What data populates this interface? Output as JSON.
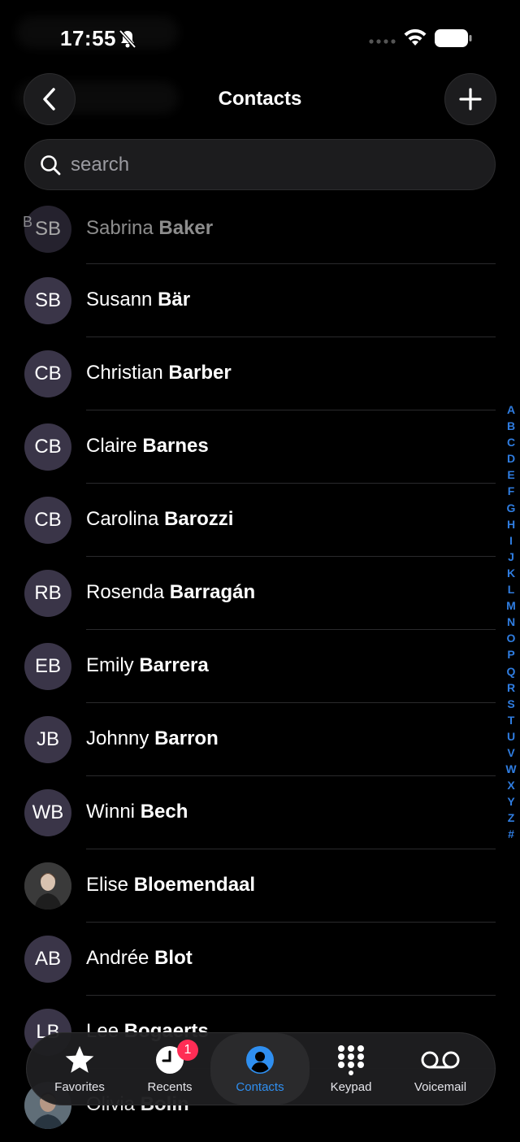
{
  "status_bar": {
    "time": "17:55"
  },
  "nav": {
    "title": "Contacts"
  },
  "search": {
    "placeholder": "search"
  },
  "section_letter": "B",
  "contacts": [
    {
      "initials": "SB",
      "first": "Sabrina",
      "last": "Baker"
    },
    {
      "initials": "SB",
      "first": "Susann",
      "last": "Bär"
    },
    {
      "initials": "CB",
      "first": "Christian",
      "last": "Barber"
    },
    {
      "initials": "CB",
      "first": "Claire",
      "last": "Barnes"
    },
    {
      "initials": "CB",
      "first": "Carolina",
      "last": "Barozzi"
    },
    {
      "initials": "RB",
      "first": "Rosenda",
      "last": "Barragán"
    },
    {
      "initials": "EB",
      "first": "Emily",
      "last": "Barrera"
    },
    {
      "initials": "JB",
      "first": "Johnny",
      "last": "Barron"
    },
    {
      "initials": "WB",
      "first": "Winni",
      "last": "Bech"
    },
    {
      "initials": "",
      "first": "Elise",
      "last": "Bloemendaal"
    },
    {
      "initials": "AB",
      "first": "Andrée",
      "last": "Blot"
    },
    {
      "initials": "LB",
      "first": "Lee",
      "last": "Bogaerts"
    },
    {
      "initials": "",
      "first": "Olivia",
      "last": "Bolin"
    }
  ],
  "index_letters": [
    "A",
    "B",
    "C",
    "D",
    "E",
    "F",
    "G",
    "H",
    "I",
    "J",
    "K",
    "L",
    "M",
    "N",
    "O",
    "P",
    "Q",
    "R",
    "S",
    "T",
    "U",
    "V",
    "W",
    "X",
    "Y",
    "Z",
    "#"
  ],
  "tabs": [
    {
      "label": "Favorites",
      "icon": "star-icon"
    },
    {
      "label": "Recents",
      "icon": "clock-icon",
      "badge": "1"
    },
    {
      "label": "Contacts",
      "icon": "person-icon",
      "active": true
    },
    {
      "label": "Keypad",
      "icon": "keypad-icon"
    },
    {
      "label": "Voicemail",
      "icon": "voicemail-icon"
    }
  ],
  "colors": {
    "accent": "#2f8ff0",
    "badge": "#ff2d55",
    "avatar_bg": "#3a3548"
  }
}
